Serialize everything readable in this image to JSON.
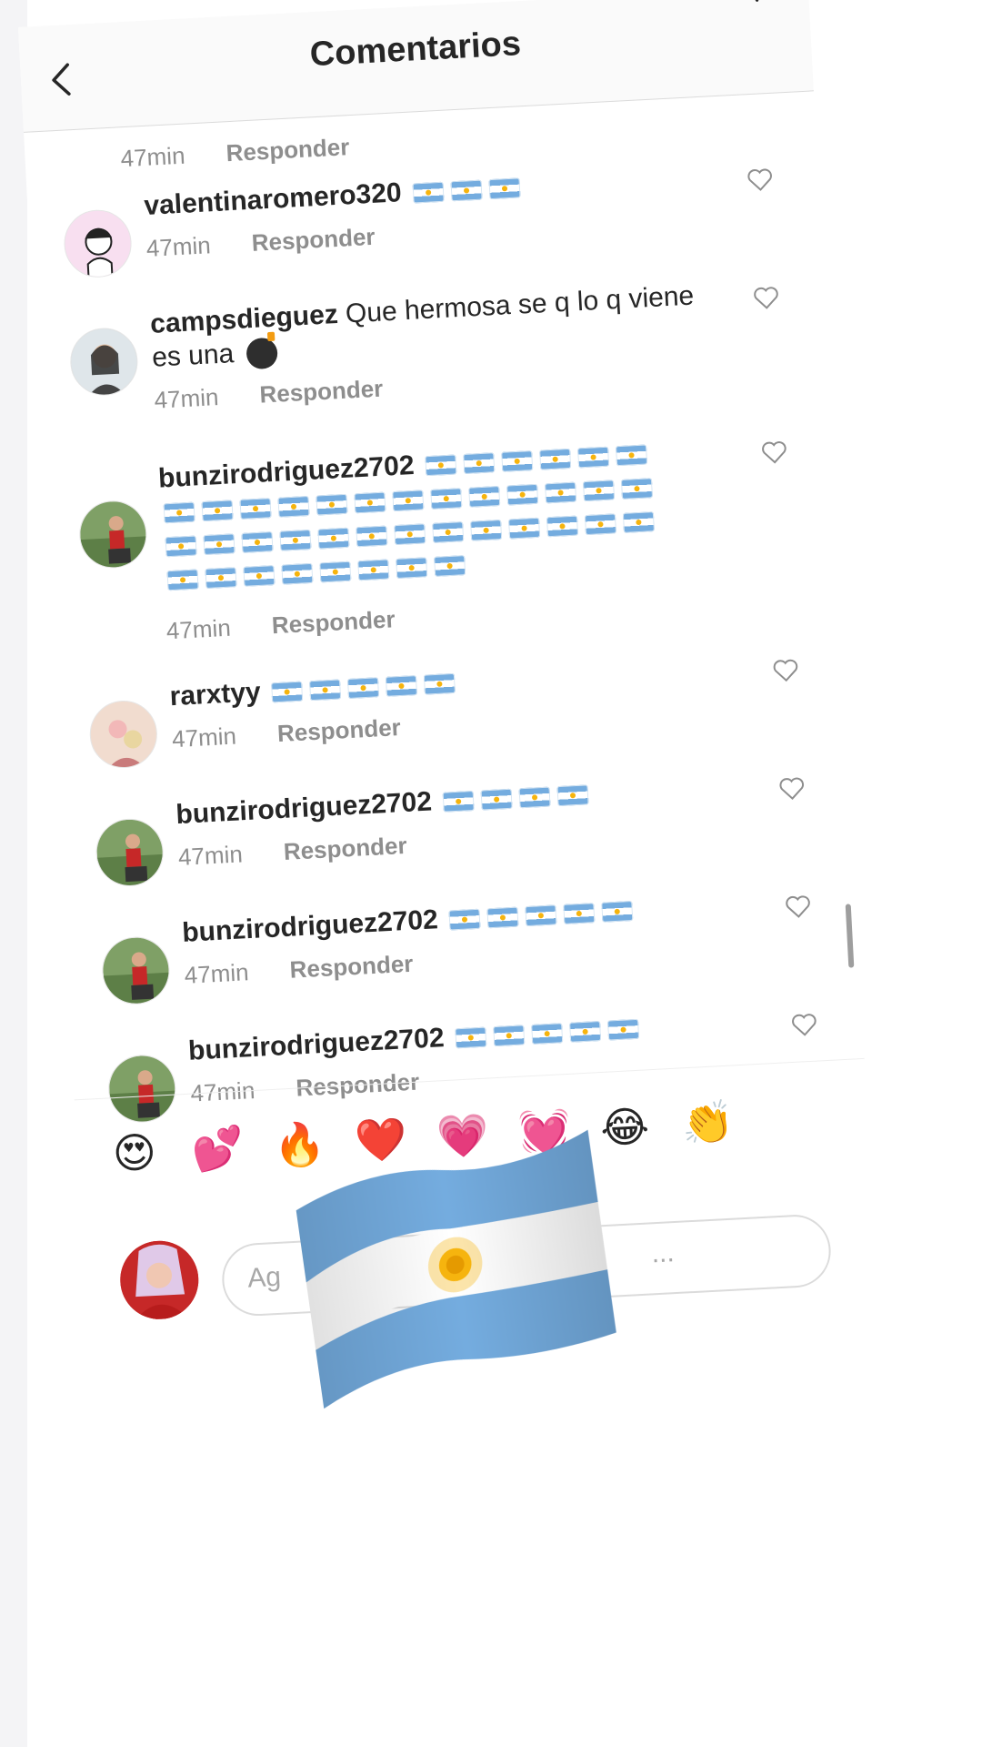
{
  "header": {
    "title": "Comentarios"
  },
  "partial_comment": {
    "time": "47min",
    "reply_label": "Responder"
  },
  "comments": [
    {
      "username": "valentinaromero320",
      "text": "",
      "flag_count": 3,
      "time": "47min",
      "reply_label": "Responder"
    },
    {
      "username": "campsdieguez",
      "text": "Que hermosa se q lo q viene es una",
      "emoji": "bomb",
      "time": "47min",
      "reply_label": "Responder"
    },
    {
      "username": "bunzirodriguez2702",
      "text": "",
      "flag_count": 40,
      "time": "47min",
      "reply_label": "Responder"
    },
    {
      "username": "rarxtyy",
      "text": "",
      "flag_count": 5,
      "time": "47min",
      "reply_label": "Responder"
    },
    {
      "username": "bunzirodriguez2702",
      "text": "",
      "flag_count": 4,
      "time": "47min",
      "reply_label": "Responder"
    },
    {
      "username": "bunzirodriguez2702",
      "text": "",
      "flag_count": 5,
      "time": "47min",
      "reply_label": "Responder"
    },
    {
      "username": "bunzirodriguez2702",
      "text": "",
      "flag_count": 5,
      "time": "47min",
      "reply_label": "Responder"
    }
  ],
  "emoji_bar": {
    "emojis": [
      "😍",
      "💕",
      "🔥",
      "❤️",
      "💗",
      "💓",
      "😂",
      "👏"
    ]
  },
  "input": {
    "placeholder": "Ag",
    "trailing": "..."
  },
  "colors": {
    "flag_blue": "#74acdf",
    "sun_gold": "#f6b40e",
    "muted_text": "#8e8e8e"
  }
}
